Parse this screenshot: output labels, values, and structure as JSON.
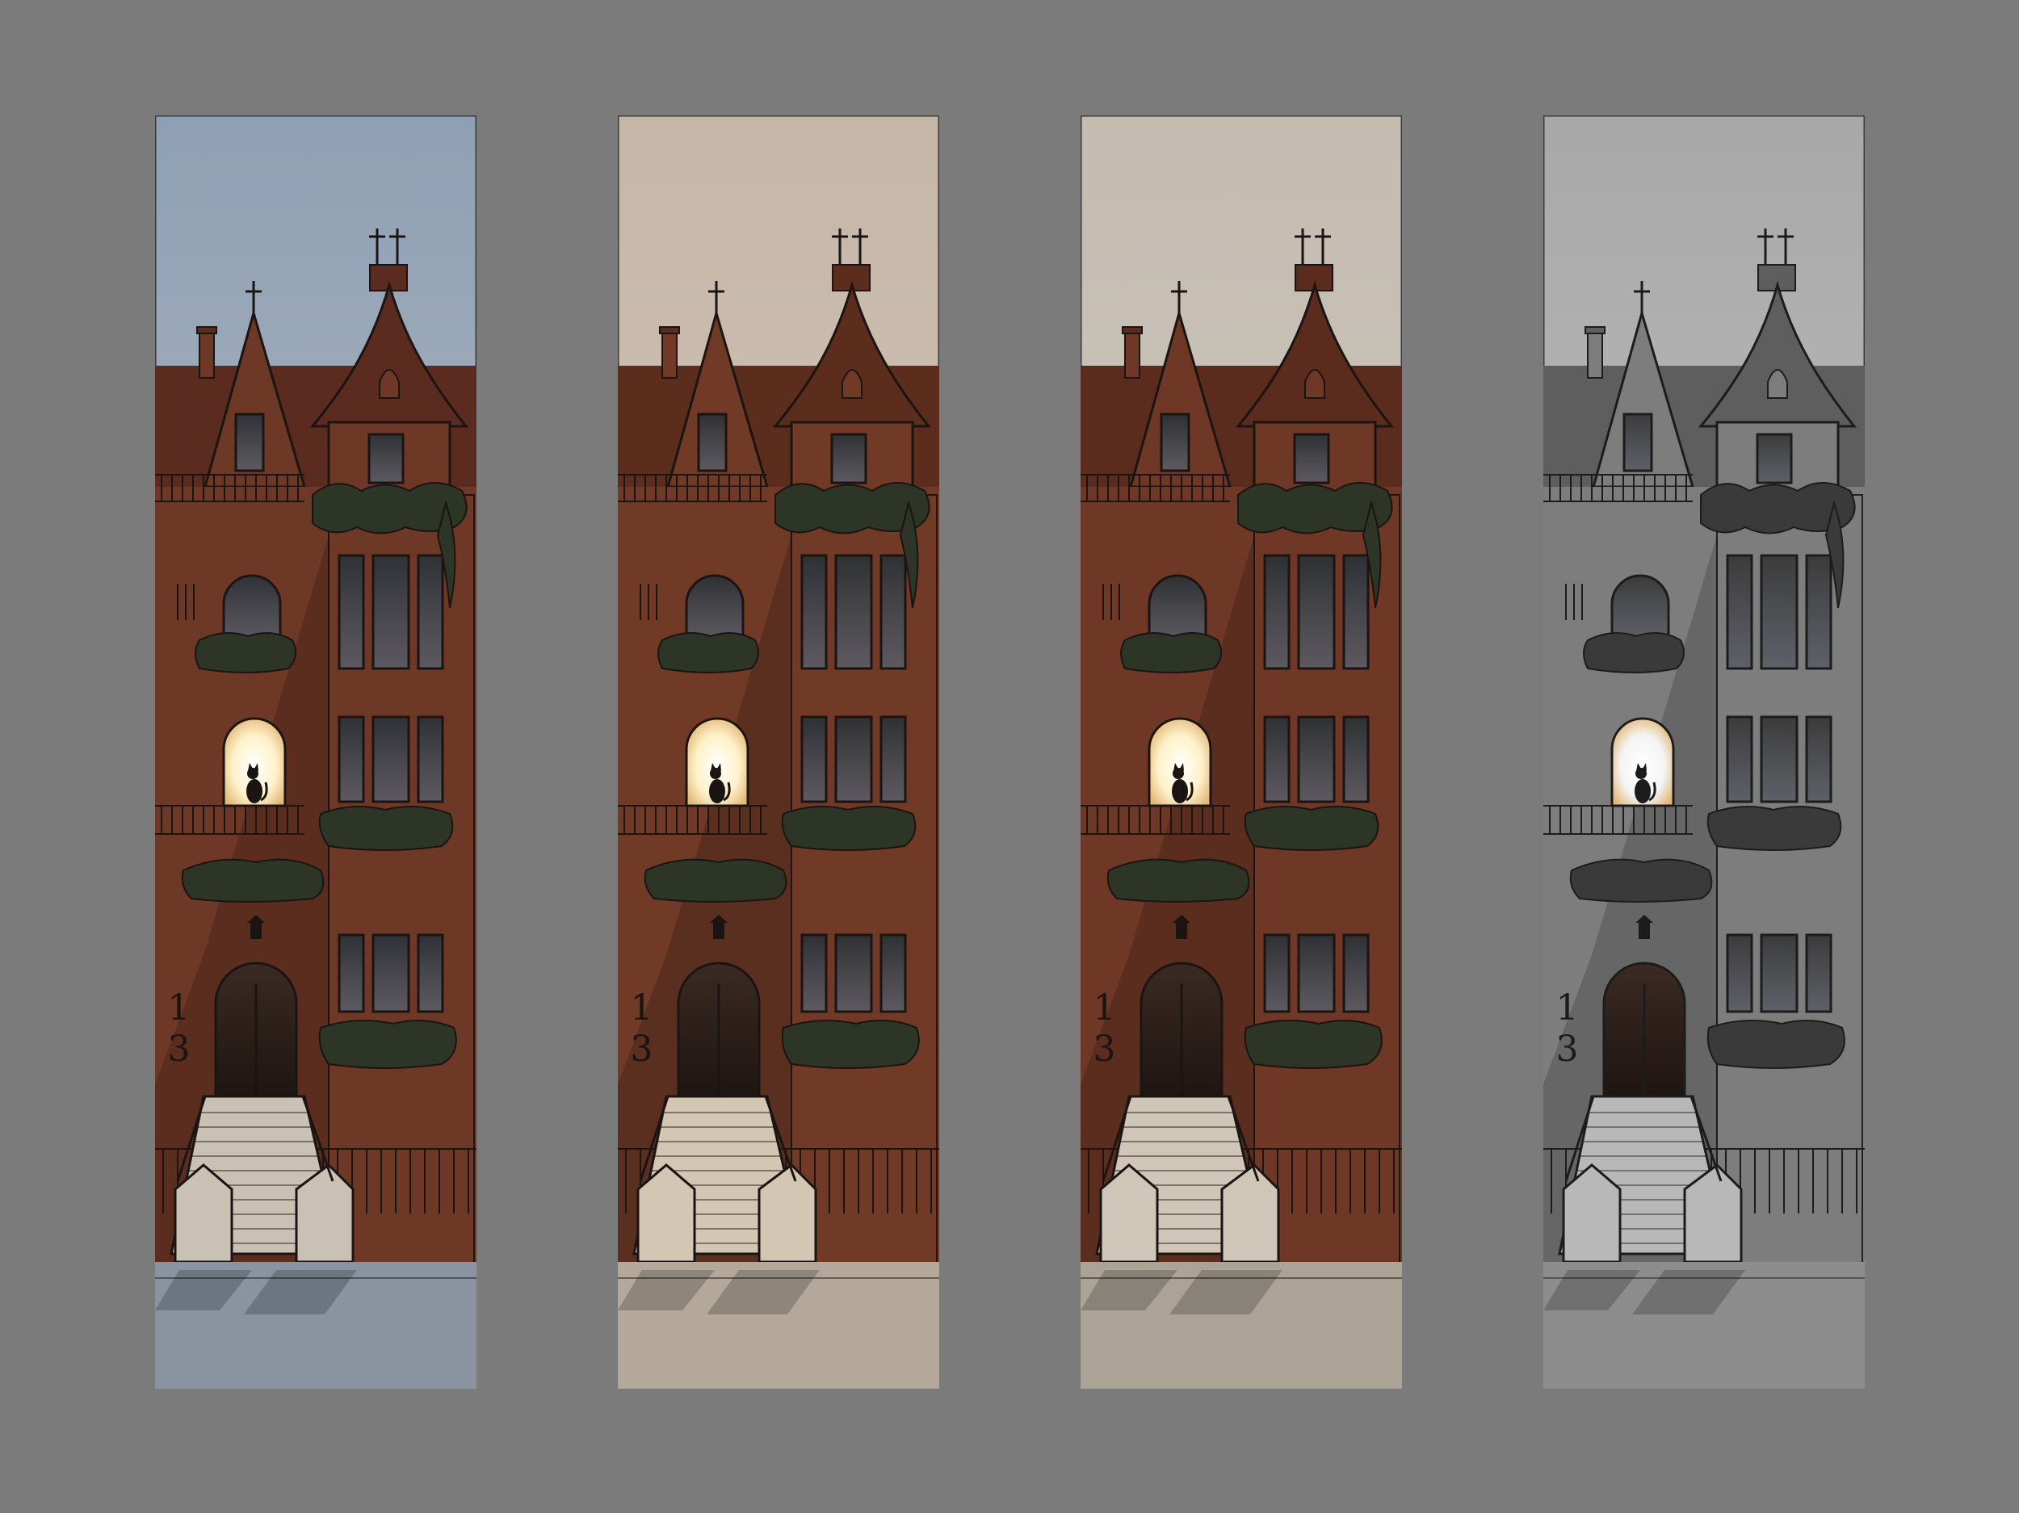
{
  "canvas": {
    "background": "#7b7b7b"
  },
  "house_number": "13",
  "panels": [
    {
      "id": "blue-dusk",
      "sky_top": "#8fa0b4",
      "sky_bottom": "#c7c9cc",
      "brick": "#6e3826",
      "roof": "#5a2b1e",
      "window": "#2f3136",
      "window_glow": "#fff1c9",
      "street": "#8994a0",
      "stair": "#c9c2b4",
      "ivy": "#2d3626",
      "ink": "#1a1412"
    },
    {
      "id": "warm-dusk",
      "sky_top": "#c6b6a8",
      "sky_bottom": "#d8cfc3",
      "brick": "#703a27",
      "roof": "#5c2c1d",
      "window": "#2f3034",
      "window_glow": "#fff1c9",
      "street": "#b3a89a",
      "stair": "#d3c6b3",
      "ivy": "#2d3626",
      "ink": "#1a1412"
    },
    {
      "id": "grey-dusk",
      "sky_top": "#c4bcb1",
      "sky_bottom": "#d6d0c8",
      "brick": "#6f3826",
      "roof": "#5b2b1d",
      "window": "#2e3034",
      "window_glow": "#fff1c9",
      "street": "#aaa396",
      "stair": "#cfc6b8",
      "ivy": "#2d3626",
      "ink": "#1a1412"
    },
    {
      "id": "greyscale",
      "sky_top": "#a8a8a8",
      "sky_bottom": "#d3d3d3",
      "brick": "#7d7d7d",
      "roof": "#5e5e5e",
      "window": "#3b3b3b",
      "window_glow": "#f4f4f4",
      "street": "#8d8d8d",
      "stair": "#b8b8b8",
      "ivy": "#3a3a3a",
      "ink": "#1c1c1c"
    }
  ]
}
